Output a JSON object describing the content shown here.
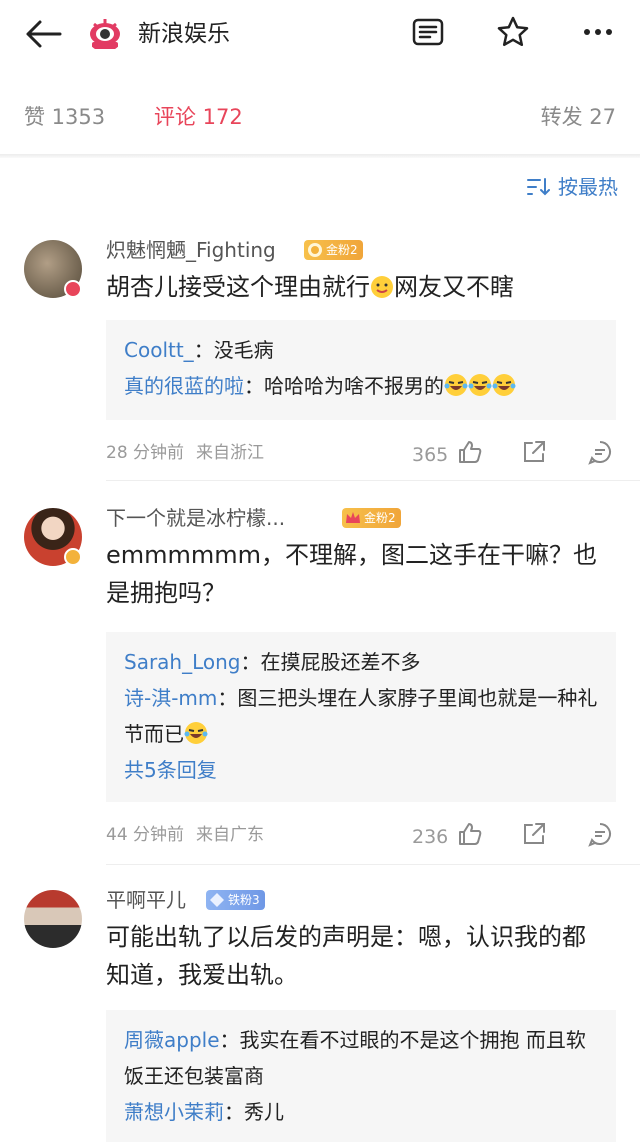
{
  "header": {
    "title": "新浪娱乐",
    "icons": [
      "back-arrow-icon",
      "sina-eye-logo",
      "article-icon",
      "star-icon",
      "more-icon"
    ]
  },
  "stats": {
    "likes": "赞 1353",
    "comments": "评论 172",
    "reposts": "转发 27"
  },
  "sort": {
    "label": "按最热",
    "icon": "sort-icon"
  },
  "comments": [
    {
      "username": "炽魅惘魉_Fighting",
      "badge": "金粉2",
      "text": "胡杏儿接受这个理由就行",
      "text_after": "网友又不瞎",
      "replies": [
        {
          "name": "Cooltt_",
          "sep": "：",
          "text": "没毛病"
        },
        {
          "name": "真的很蓝的啦",
          "sep": "：",
          "text": "哈哈哈为啥不报男的"
        }
      ],
      "time": "28 分钟前",
      "location": "来自浙江",
      "likes": "365"
    },
    {
      "username": "下一个就是冰柠檬...",
      "badge": "金粉2",
      "text": "emmmmmm，不理解，图二这手在干嘛？也是拥抱吗？",
      "replies": [
        {
          "name": "Sarah_Long",
          "sep": "：",
          "text": "在摸屁股还差不多"
        },
        {
          "name": "诗-淇-mm",
          "sep": "：",
          "text": "图三把头埋在人家脖子里闻也就是一种礼节而已"
        }
      ],
      "more_replies": "共5条回复",
      "time": "44 分钟前",
      "location": "来自广东",
      "likes": "236"
    },
    {
      "username": "平啊平儿",
      "badge": "铁粉3",
      "text": "可能出轨了以后发的声明是：嗯，认识我的都知道，我爱出轨。",
      "replies": [
        {
          "name": "周薇apple",
          "sep": "：",
          "text": "我实在看不过眼的不是这个拥抱 而且软饭王还包装富商"
        },
        {
          "name": "萧想小茉莉",
          "sep": "：",
          "text": "秀儿"
        }
      ]
    }
  ],
  "colors": {
    "accent": "#e8455a",
    "link": "#3f7ec8",
    "reply_bg": "#f6f6f6"
  }
}
